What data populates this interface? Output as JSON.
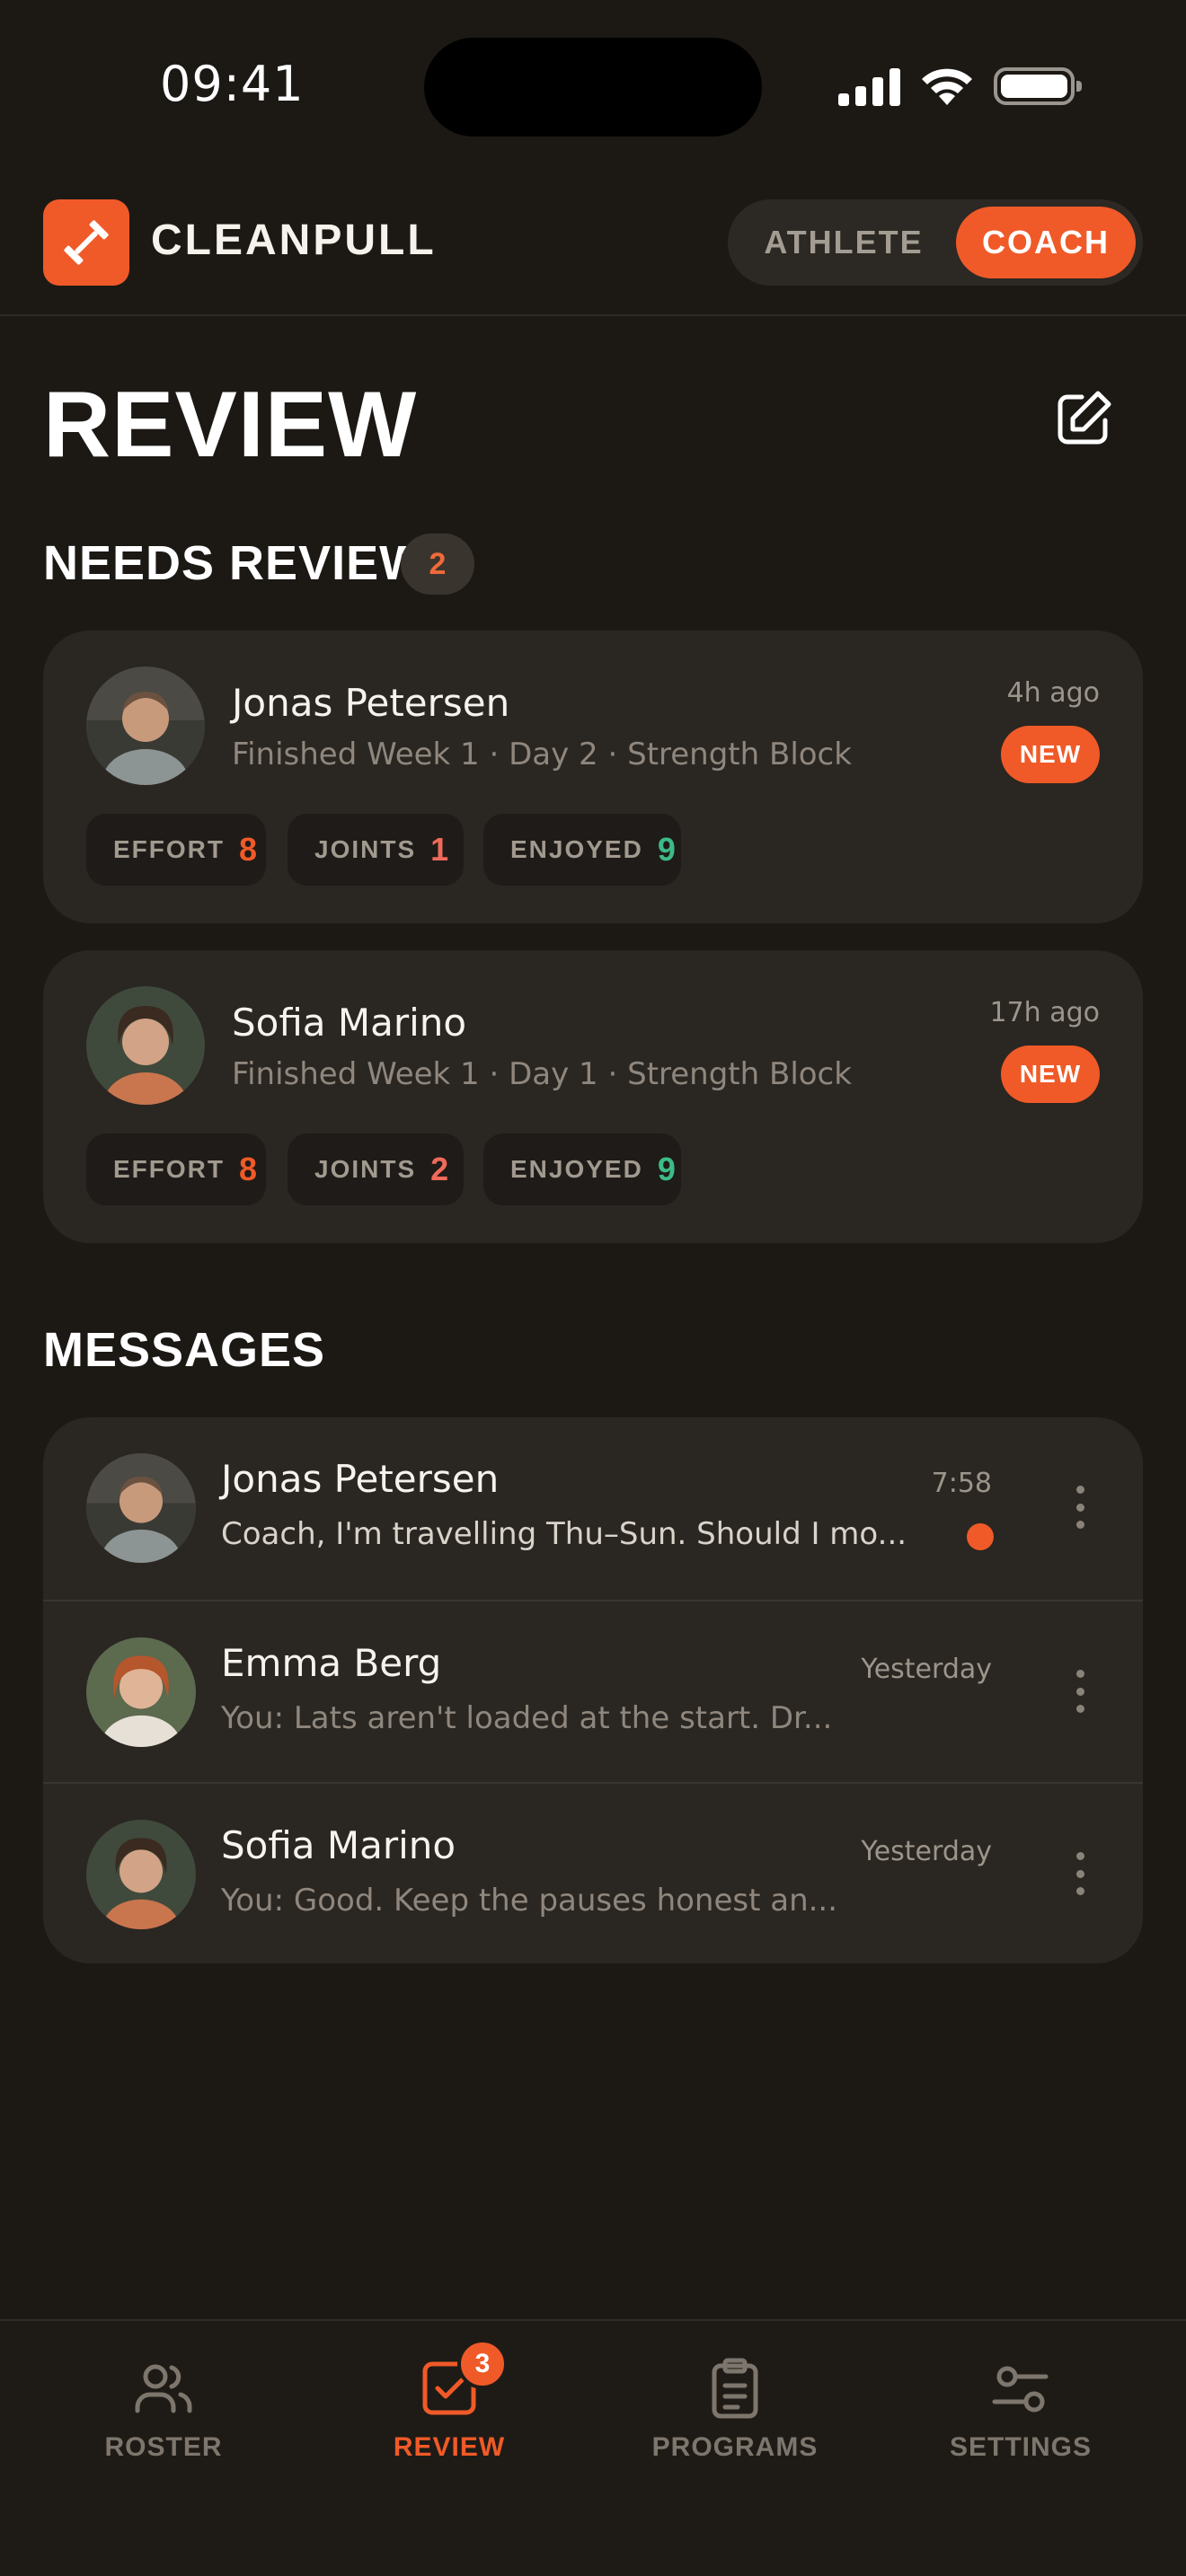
{
  "status_bar": {
    "time": "09:41"
  },
  "app": {
    "brand": "CLEANPULL",
    "roles": [
      "ATHLETE",
      "COACH"
    ],
    "active_role": "COACH",
    "accent": "#f05a28"
  },
  "page": {
    "title": "REVIEW"
  },
  "needs_review": {
    "title": "NEEDS REVIEW",
    "count": "2",
    "items": [
      {
        "name": "Jonas Petersen",
        "subtitle": "Finished Week 1 · Day 2 · Strength Block",
        "time": "4h ago",
        "badge": "NEW",
        "metrics": [
          {
            "label": "EFFORT",
            "value": "8",
            "color": "#f05a28"
          },
          {
            "label": "JOINTS",
            "value": "1",
            "color": "#f06a5a"
          },
          {
            "label": "ENJOYED",
            "value": "9",
            "color": "#3dbb86"
          }
        ]
      },
      {
        "name": "Sofia Marino",
        "subtitle": "Finished Week 1 · Day 1 · Strength Block",
        "time": "17h ago",
        "badge": "NEW",
        "metrics": [
          {
            "label": "EFFORT",
            "value": "8",
            "color": "#f05a28"
          },
          {
            "label": "JOINTS",
            "value": "2",
            "color": "#f06a5a"
          },
          {
            "label": "ENJOYED",
            "value": "9",
            "color": "#3dbb86"
          }
        ]
      }
    ]
  },
  "messages": {
    "title": "MESSAGES",
    "items": [
      {
        "name": "Jonas Petersen",
        "preview": "Coach, I'm travelling Thu–Sun. Should I mo...",
        "time": "7:58",
        "unread": true
      },
      {
        "name": "Emma Berg",
        "preview": "You: Lats aren't loaded at the start. Dr...",
        "time": "Yesterday",
        "unread": false
      },
      {
        "name": "Sofia Marino",
        "preview": "You: Good. Keep the pauses honest an...",
        "time": "Yesterday",
        "unread": false
      }
    ]
  },
  "tab_bar": {
    "tabs": [
      {
        "label": "ROSTER",
        "icon": "users-icon"
      },
      {
        "label": "REVIEW",
        "icon": "checkbox-icon",
        "badge": "3",
        "active": true
      },
      {
        "label": "PROGRAMS",
        "icon": "clipboard-icon"
      },
      {
        "label": "SETTINGS",
        "icon": "sliders-icon"
      }
    ]
  }
}
